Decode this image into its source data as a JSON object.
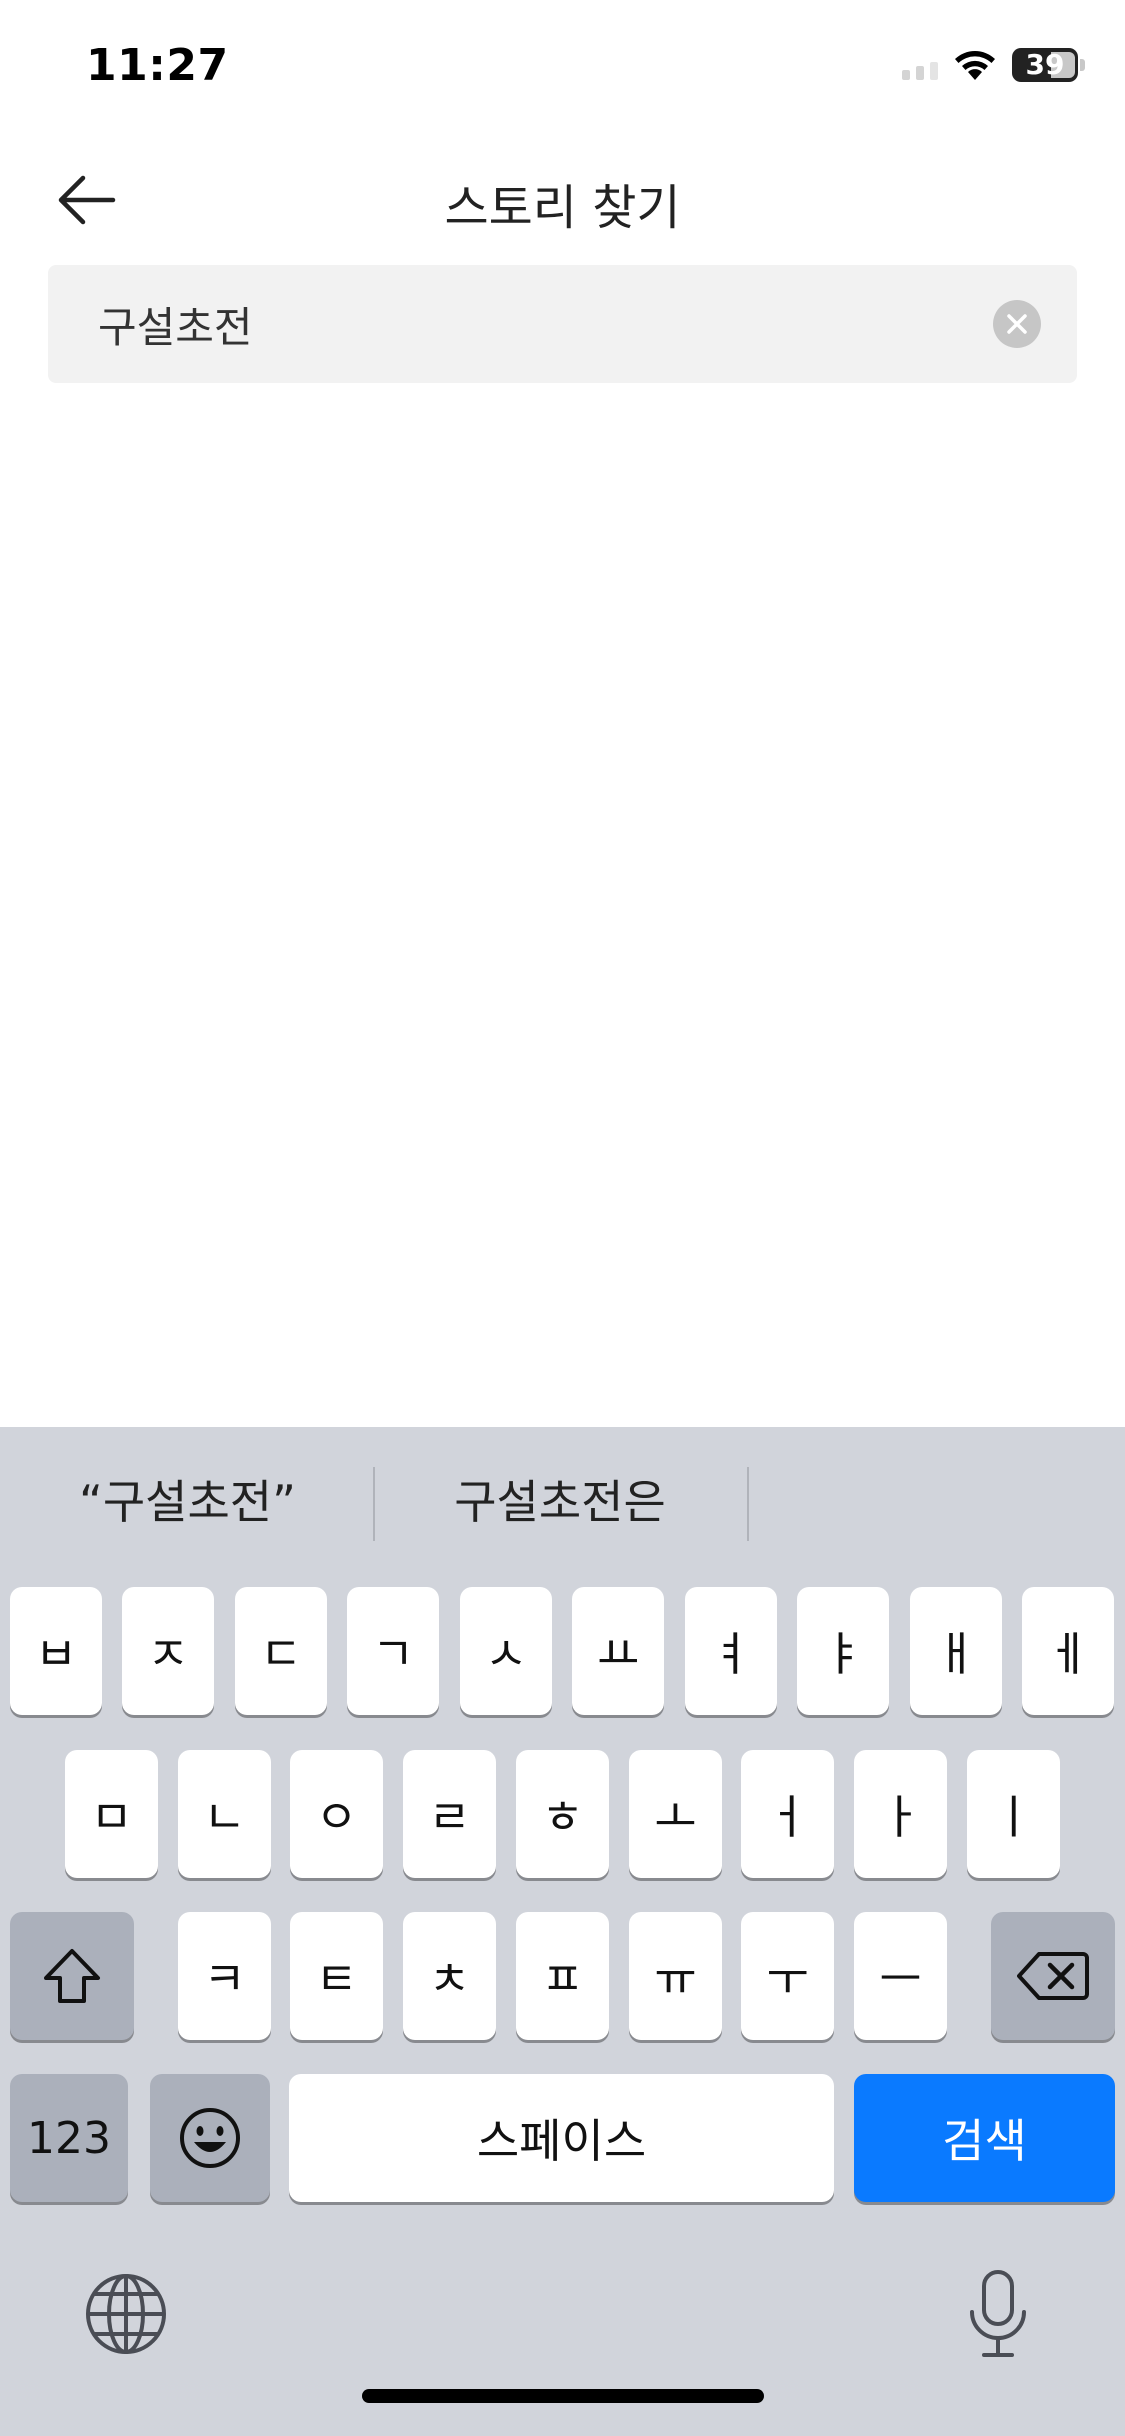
{
  "status_bar": {
    "time": "11:27",
    "battery": "39"
  },
  "header": {
    "title": "스토리 찾기"
  },
  "search": {
    "value": "구설초전"
  },
  "keyboard": {
    "suggestions": [
      "“구설초전”",
      "구설초전은"
    ],
    "row1": [
      "ㅂ",
      "ㅈ",
      "ㄷ",
      "ㄱ",
      "ㅅ",
      "ㅛ",
      "ㅕ",
      "ㅑ",
      "ㅐ",
      "ㅔ"
    ],
    "row2": [
      "ㅁ",
      "ㄴ",
      "ㅇ",
      "ㄹ",
      "ㅎ",
      "ㅗ",
      "ㅓ",
      "ㅏ",
      "ㅣ"
    ],
    "row3": [
      "ㅋ",
      "ㅌ",
      "ㅊ",
      "ㅍ",
      "ㅠ",
      "ㅜ",
      "ㅡ"
    ],
    "numbers_label": "123",
    "space_label": "스페이스",
    "search_label": "검색"
  },
  "colors": {
    "accent": "#0a7aff",
    "keyboard_bg": "#d1d4db",
    "search_bg": "#f2f2f2"
  }
}
